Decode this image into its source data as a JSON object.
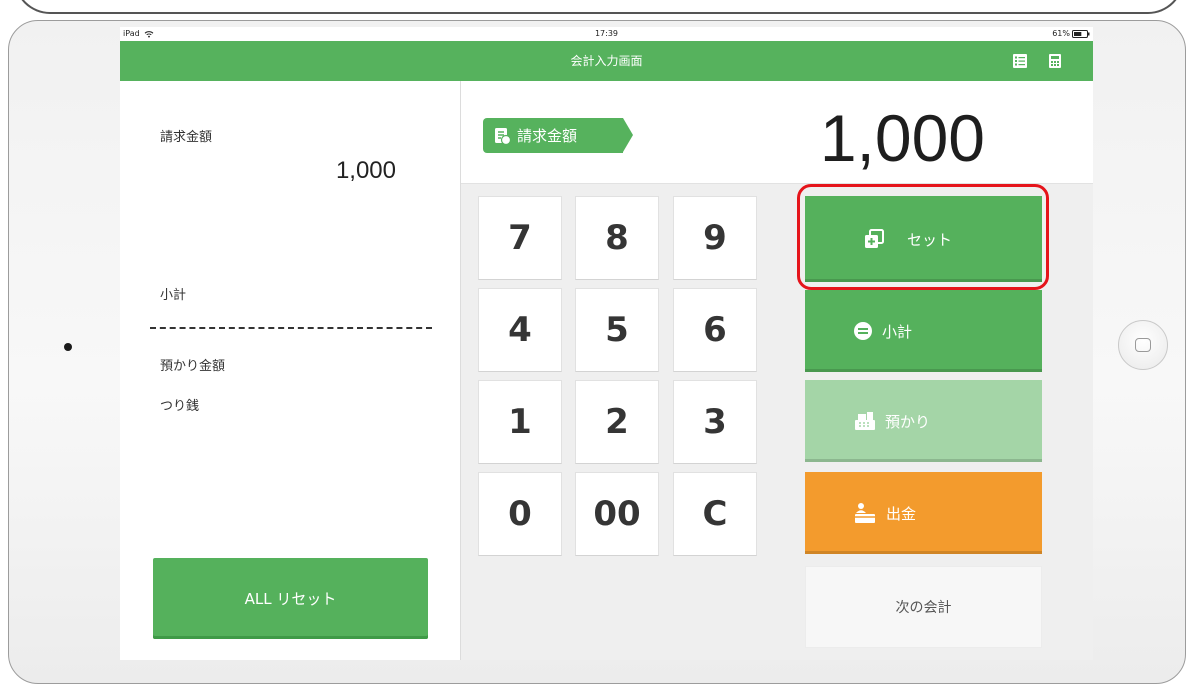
{
  "status_bar": {
    "device": "iPad",
    "time": "17:39",
    "battery_percent": "61%",
    "battery_level": 0.61
  },
  "header": {
    "title": "会計入力画面",
    "icons": {
      "left": "list-icon",
      "right": "calculator-icon"
    }
  },
  "summary": {
    "billing_label": "請求金額",
    "billing_amount": "1,000",
    "subtotal_label": "小計",
    "deposit_label": "預かり金額",
    "change_label": "つり銭",
    "reset_button": "ALL リセット"
  },
  "display": {
    "tag_label": "請求金額",
    "tag_icon": "receipt-icon",
    "amount": "1,000"
  },
  "keypad": {
    "keys": [
      "7",
      "8",
      "9",
      "4",
      "5",
      "6",
      "1",
      "2",
      "3",
      "0",
      "00",
      "C"
    ]
  },
  "actions": {
    "set": {
      "label": "セット",
      "icon": "add-copy-icon"
    },
    "subtotal": {
      "label": "小計",
      "icon": "menu-circle-icon"
    },
    "deposit": {
      "label": "預かり",
      "icon": "cash-register-icon"
    },
    "withdraw": {
      "label": "出金",
      "icon": "payout-icon"
    },
    "next": {
      "label": "次の会計"
    }
  },
  "colors": {
    "header_green": "#56b25d",
    "button_green": "#55b15c",
    "deposit_green": "#a4d5a7",
    "withdraw_orange": "#f39b2d",
    "highlight_red": "#e5141b"
  }
}
